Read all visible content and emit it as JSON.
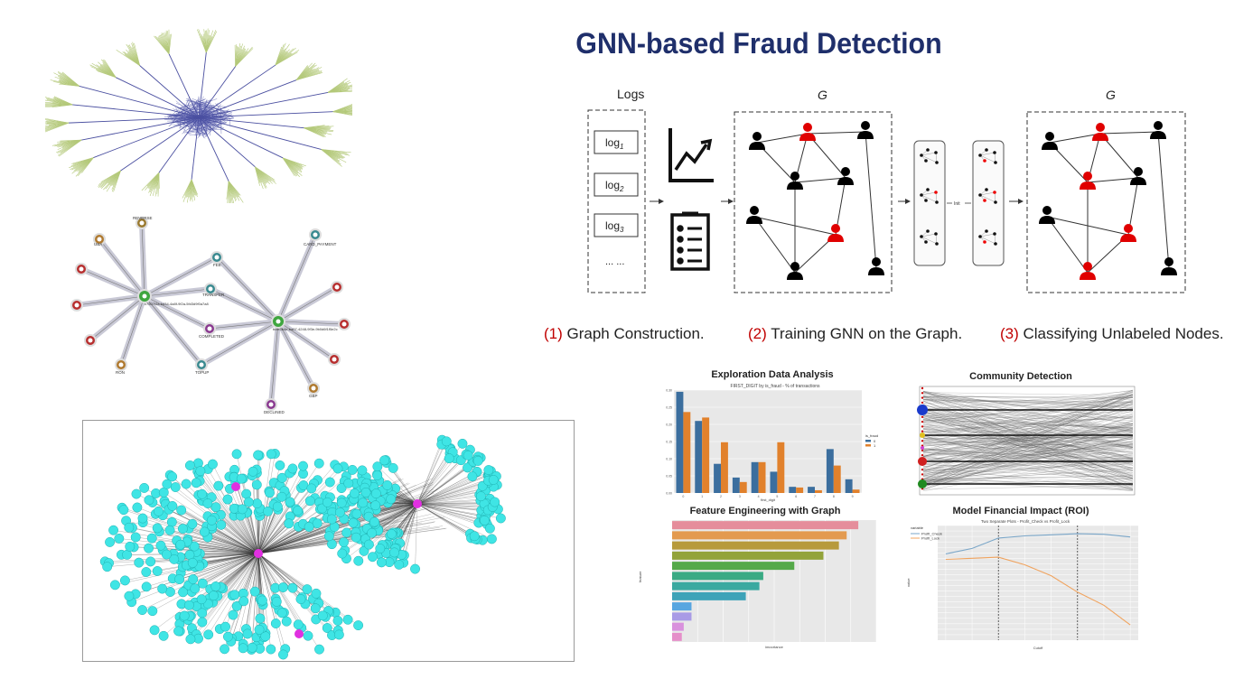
{
  "slide": {
    "title": "GNN-based Fraud Detection"
  },
  "pipeline": {
    "logs_heading": "Logs",
    "logs": [
      "log",
      "log",
      "log"
    ],
    "log_subscripts": [
      "1",
      "2",
      "3"
    ],
    "logs_more": "... ...",
    "graph_label": "G",
    "model_label": "Init",
    "steps": [
      {
        "num": "(1)",
        "text": " Graph Construction."
      },
      {
        "num": "(2)",
        "text": " Training GNN on the Graph."
      },
      {
        "num": "(3)",
        "text": " Classifying Unlabeled Nodes."
      }
    ],
    "fraud_color": "#e00000",
    "normal_color": "#000000"
  },
  "knowledge_graph": {
    "center_nodes": [
      "c7507f4a-bd34-4a8f-9f2a-5fd3d9f0a7a8",
      "bcfe3b4e-ba07-4248-9f3e-9b0d6f1f5e2c"
    ],
    "nodes": [
      "REVERSE",
      "USA",
      "FEE",
      "TRANSFER",
      "COMPLETED",
      "TOPUP",
      "DECLINED",
      "CARD_PAYMENT",
      "GBP",
      "RON"
    ]
  },
  "panels": {
    "eda": {
      "title": "Exploration Data Analysis",
      "subtitle": "FIRST_DIGIT by is_fraud - % of transactions",
      "xlabel": "first_digit",
      "legend_title": "is_fraud",
      "legend": [
        "0",
        "1"
      ]
    },
    "community": {
      "title": "Community Detection"
    },
    "feature": {
      "title": "Feature Engineering with Graph",
      "xlabel": "importance",
      "ylabel": "feature"
    },
    "roi": {
      "title": "Model Financial Impact (ROI)",
      "subtitle": "Two Separate Plots - Profit_Check vs Profit_Lock",
      "legend_title": "variable",
      "legend": [
        "Profit_Check",
        "Profit_Lock"
      ],
      "xlabel": "Cutoff",
      "ylabel": "value"
    }
  },
  "chart_data": [
    {
      "type": "bar",
      "title": "Exploration Data Analysis",
      "subtitle": "FIRST_DIGIT by is_fraud - % of transactions",
      "xlabel": "first_digit",
      "categories": [
        "0",
        "1",
        "2",
        "3",
        "4",
        "5",
        "6",
        "7",
        "8",
        "9"
      ],
      "series": [
        {
          "name": "0",
          "values": [
            0.295,
            0.21,
            0.085,
            0.045,
            0.09,
            0.062,
            0.018,
            0.018,
            0.128,
            0.04
          ],
          "color": "#3b6e9e"
        },
        {
          "name": "1",
          "values": [
            0.236,
            0.22,
            0.148,
            0.032,
            0.09,
            0.148,
            0.016,
            0.008,
            0.08,
            0.01
          ],
          "color": "#e1812c"
        }
      ],
      "ylim": [
        0,
        0.3
      ],
      "yticks": [
        "0.00",
        "0.05",
        "0.10",
        "0.15",
        "0.20",
        "0.25",
        "0.30"
      ],
      "legend_title": "is_fraud",
      "legend_position": "right",
      "grid": true
    },
    {
      "type": "bar",
      "orientation": "horizontal",
      "title": "Feature Engineering with Graph",
      "xlabel": "importance",
      "ylabel": "feature",
      "values": [
        0.96,
        0.9,
        0.86,
        0.78,
        0.63,
        0.47,
        0.45,
        0.38,
        0.1,
        0.1,
        0.06,
        0.05
      ],
      "colors": [
        "#e58d9b",
        "#e39a4f",
        "#b79a3c",
        "#93a33a",
        "#55a94a",
        "#3aaa84",
        "#3aa9a0",
        "#3ea3b8",
        "#58a6e0",
        "#a99be6",
        "#d991dd",
        "#e58fc9"
      ],
      "grid": true
    },
    {
      "type": "line",
      "title": "Model Financial Impact (ROI)",
      "subtitle": "Two Separate Plots - Profit_Check vs Profit_Lock",
      "xlabel": "Cutoff",
      "ylabel": "value",
      "x": [
        0.0,
        0.01,
        0.02,
        0.03,
        0.04,
        0.05,
        0.06,
        0.07
      ],
      "series": [
        {
          "name": "Profit_Check",
          "values": [
            4000000,
            9000000,
            18500000,
            20500000,
            21500000,
            22500000,
            22000000,
            19500000
          ],
          "color": "#7aa6c8"
        },
        {
          "name": "Profit_Lock",
          "values": [
            -1000000,
            0,
            1000000,
            -6000000,
            -16000000,
            -31000000,
            -43000000,
            -61000000
          ],
          "color": "#f0a35e"
        }
      ],
      "vlines": [
        0.02,
        0.05
      ],
      "legend_title": "variable",
      "legend_position": "top-left",
      "grid": true
    }
  ]
}
